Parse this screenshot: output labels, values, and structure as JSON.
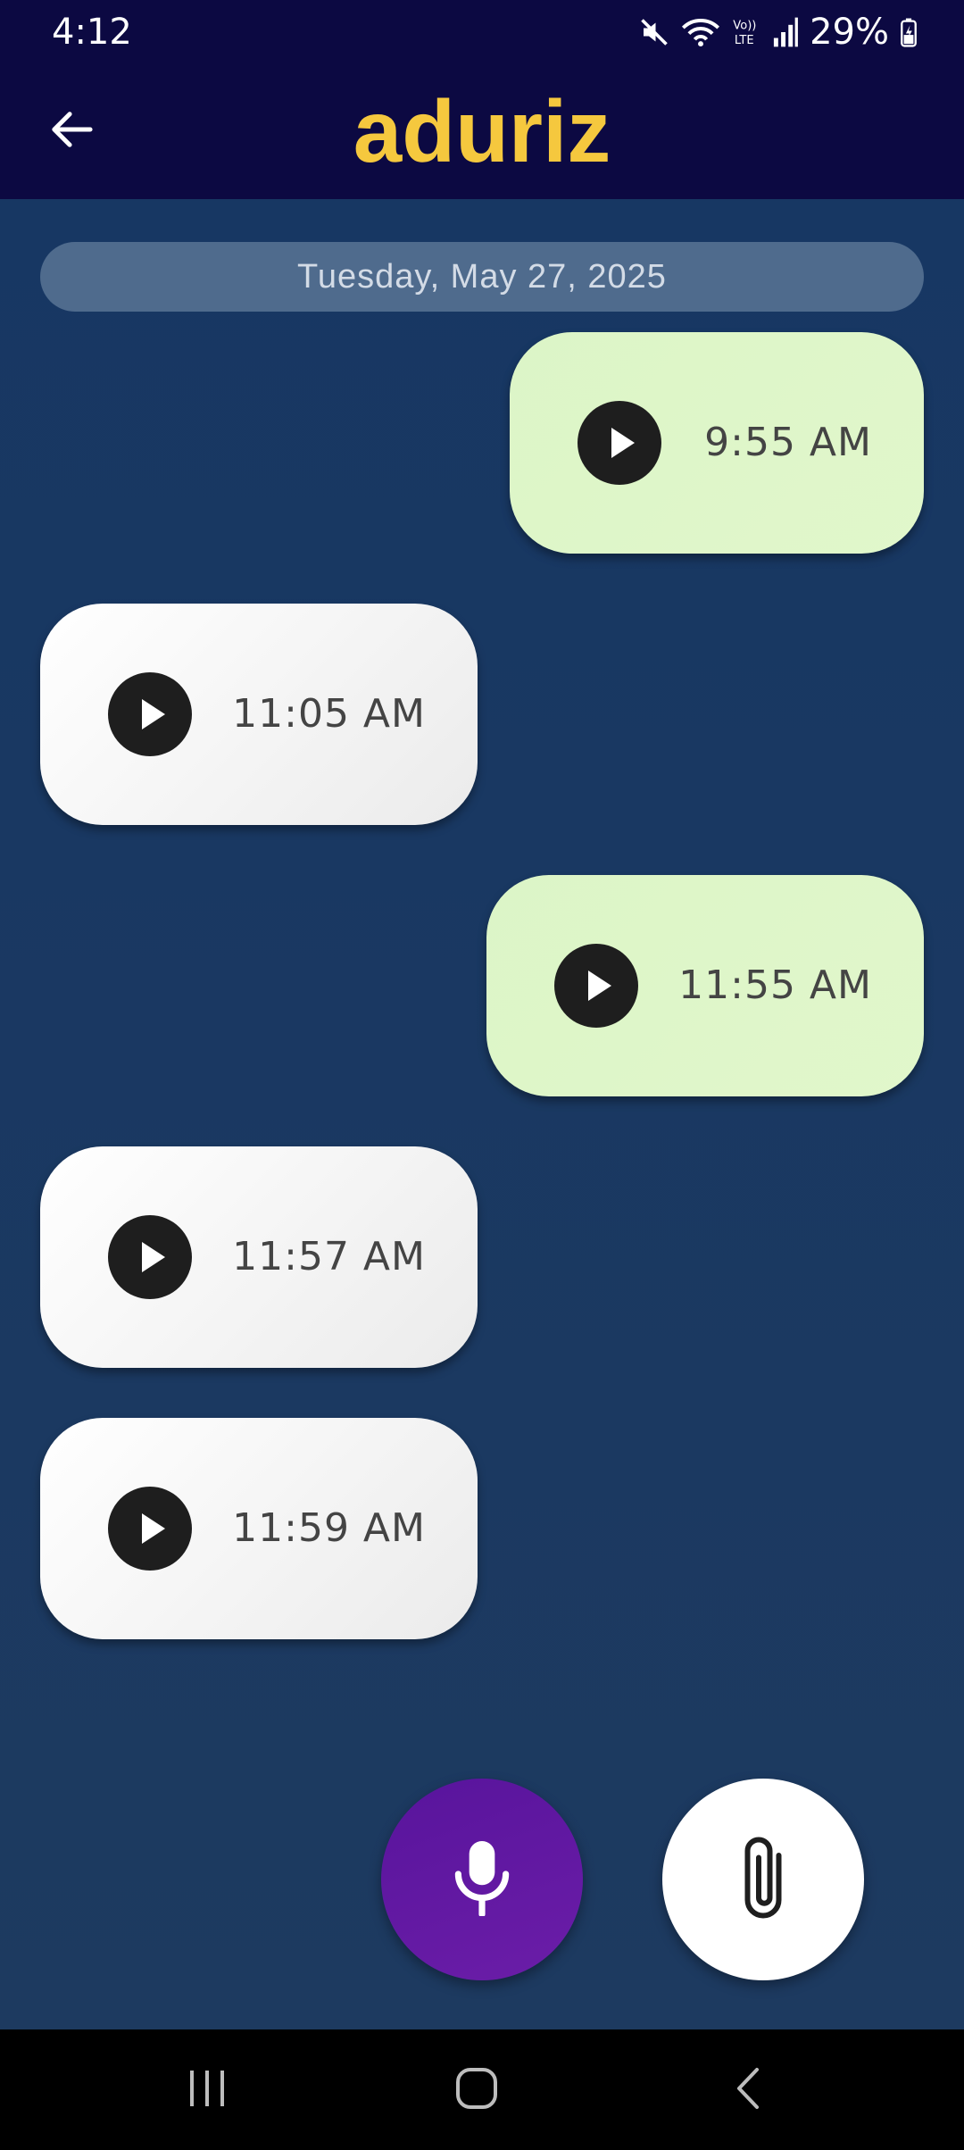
{
  "status_bar": {
    "time": "4:12",
    "battery": "29%",
    "icons": [
      "mute-icon",
      "wifi-icon",
      "volte-icon",
      "signal-icon",
      "battery-charging-icon"
    ]
  },
  "app_bar": {
    "back_icon": "arrow-left-icon",
    "title": "aduriz",
    "title_color": "#f5c83e"
  },
  "chat": {
    "date_label": "Tuesday, May 27, 2025",
    "messages": [
      {
        "direction": "sent",
        "type": "voice",
        "time": "9:55 AM"
      },
      {
        "direction": "received",
        "type": "voice",
        "time": "11:05 AM"
      },
      {
        "direction": "sent",
        "type": "voice",
        "time": "11:55 AM"
      },
      {
        "direction": "received",
        "type": "voice",
        "time": "11:57 AM"
      },
      {
        "direction": "received",
        "type": "voice",
        "time": "11:59 AM"
      }
    ]
  },
  "actions": {
    "record_icon": "microphone-icon",
    "attach_icon": "paperclip-icon"
  },
  "nav_bar": {
    "items": [
      "recent-apps-icon",
      "home-icon",
      "back-icon"
    ]
  },
  "colors": {
    "header_bg": "#0c0942",
    "chat_bg": "#1b3a60",
    "sent_bubble": "#dcf5c7",
    "received_bubble": "#ffffff",
    "mic_button": "#5e179f"
  }
}
